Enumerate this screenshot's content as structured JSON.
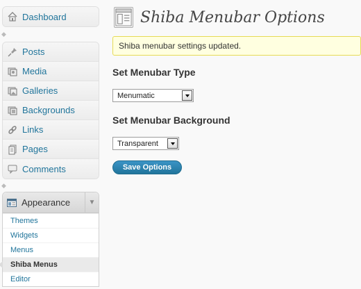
{
  "sidebar": {
    "dashboard": {
      "label": "Dashboard",
      "icon": "house-icon"
    },
    "content_items": [
      {
        "label": "Posts",
        "icon": "pushpin-icon"
      },
      {
        "label": "Media",
        "icon": "media-icon"
      },
      {
        "label": "Galleries",
        "icon": "gallery-icon"
      },
      {
        "label": "Backgrounds",
        "icon": "background-icon"
      },
      {
        "label": "Links",
        "icon": "link-icon"
      },
      {
        "label": "Pages",
        "icon": "pages-icon"
      },
      {
        "label": "Comments",
        "icon": "comment-icon"
      }
    ],
    "appearance": {
      "label": "Appearance",
      "icon": "appearance-icon",
      "submenu": [
        {
          "label": "Themes"
        },
        {
          "label": "Widgets"
        },
        {
          "label": "Menus"
        },
        {
          "label": "Shiba Menus",
          "current": true
        },
        {
          "label": "Editor"
        }
      ]
    }
  },
  "main": {
    "title": "Shiba Menubar Options",
    "notice": "Shiba menubar settings updated.",
    "menubar_type": {
      "heading": "Set Menubar Type",
      "selected": "Menumatic"
    },
    "menubar_background": {
      "heading": "Set Menubar Background",
      "selected": "Transparent"
    },
    "save_label": "Save Options"
  },
  "colors": {
    "link": "#21759b",
    "notice_bg": "#ffffe0",
    "notice_border": "#e6db55",
    "button": "#21759b"
  }
}
